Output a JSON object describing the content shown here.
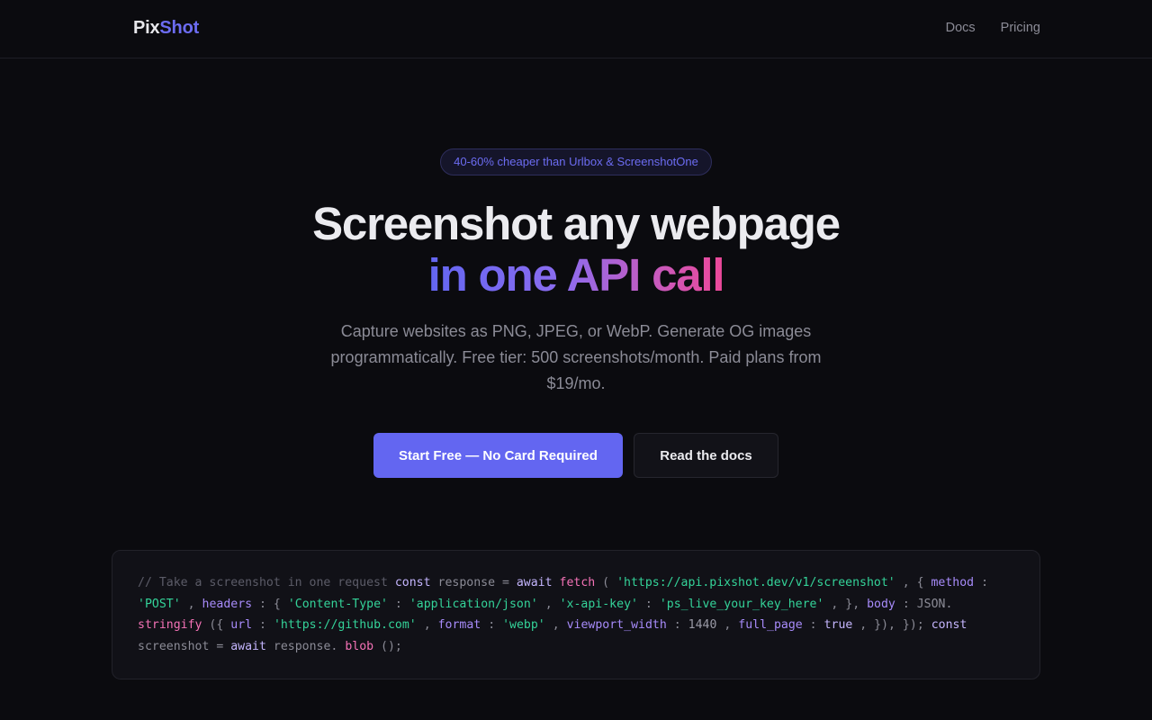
{
  "nav": {
    "logo_part1": "Pix",
    "logo_part2": "Shot",
    "links": [
      "Docs",
      "Pricing"
    ]
  },
  "hero": {
    "badge": "40-60% cheaper than Urlbox & ScreenshotOne",
    "title_line1": "Screenshot any webpage",
    "title_line2": "in one API call",
    "subtitle": "Capture websites as PNG, JPEG, or WebP. Generate OG images programmatically. Free tier: 500 screenshots/month. Paid plans from $19/mo.",
    "primary_cta": "Start Free — No Card Required",
    "secondary_cta": "Read the docs"
  },
  "code_sample": {
    "comment": "// Take a screenshot in one request",
    "tokens": [
      [
        "kw",
        "const"
      ],
      [
        "plain",
        "response ="
      ],
      [
        "kw",
        "await"
      ],
      [
        "fn",
        "fetch"
      ],
      [
        "plain",
        "("
      ],
      [
        "str",
        "'https://api.pixshot.dev/v1/screenshot'"
      ],
      [
        "plain",
        ", {"
      ],
      [
        "prop",
        "method"
      ],
      [
        "plain",
        ":"
      ],
      [
        "str",
        "'POST'"
      ],
      [
        "plain",
        ","
      ],
      [
        "prop",
        "headers"
      ],
      [
        "plain",
        ": {"
      ],
      [
        "str",
        "'Content-Type'"
      ],
      [
        "plain",
        ":"
      ],
      [
        "str",
        "'application/json'"
      ],
      [
        "plain",
        ","
      ],
      [
        "str",
        "'x-api-key'"
      ],
      [
        "plain",
        ":"
      ],
      [
        "str",
        "'ps_live_your_key_here'"
      ],
      [
        "plain",
        ", },"
      ],
      [
        "prop",
        "body"
      ],
      [
        "plain",
        ":"
      ],
      [
        "plain",
        "JSON."
      ],
      [
        "fn",
        "stringify"
      ],
      [
        "plain",
        "({"
      ],
      [
        "prop",
        "url"
      ],
      [
        "plain",
        ":"
      ],
      [
        "str",
        "'https://github.com'"
      ],
      [
        "plain",
        ","
      ],
      [
        "prop",
        "format"
      ],
      [
        "plain",
        ":"
      ],
      [
        "str",
        "'webp'"
      ],
      [
        "plain",
        ","
      ],
      [
        "prop",
        "viewport_width"
      ],
      [
        "plain",
        ":"
      ],
      [
        "num",
        "1440"
      ],
      [
        "plain",
        ","
      ],
      [
        "prop",
        "full_page"
      ],
      [
        "plain",
        ":"
      ],
      [
        "kw",
        "true"
      ],
      [
        "plain",
        ", }), });"
      ],
      [
        "kw",
        "const"
      ],
      [
        "plain",
        "screenshot ="
      ],
      [
        "kw",
        "await"
      ],
      [
        "plain",
        "response."
      ],
      [
        "fn",
        "blob"
      ],
      [
        "plain",
        "();"
      ]
    ]
  },
  "colors": {
    "accent": "#6366f1",
    "gradient_end": "#ec4899",
    "background": "#0b0b0f"
  }
}
